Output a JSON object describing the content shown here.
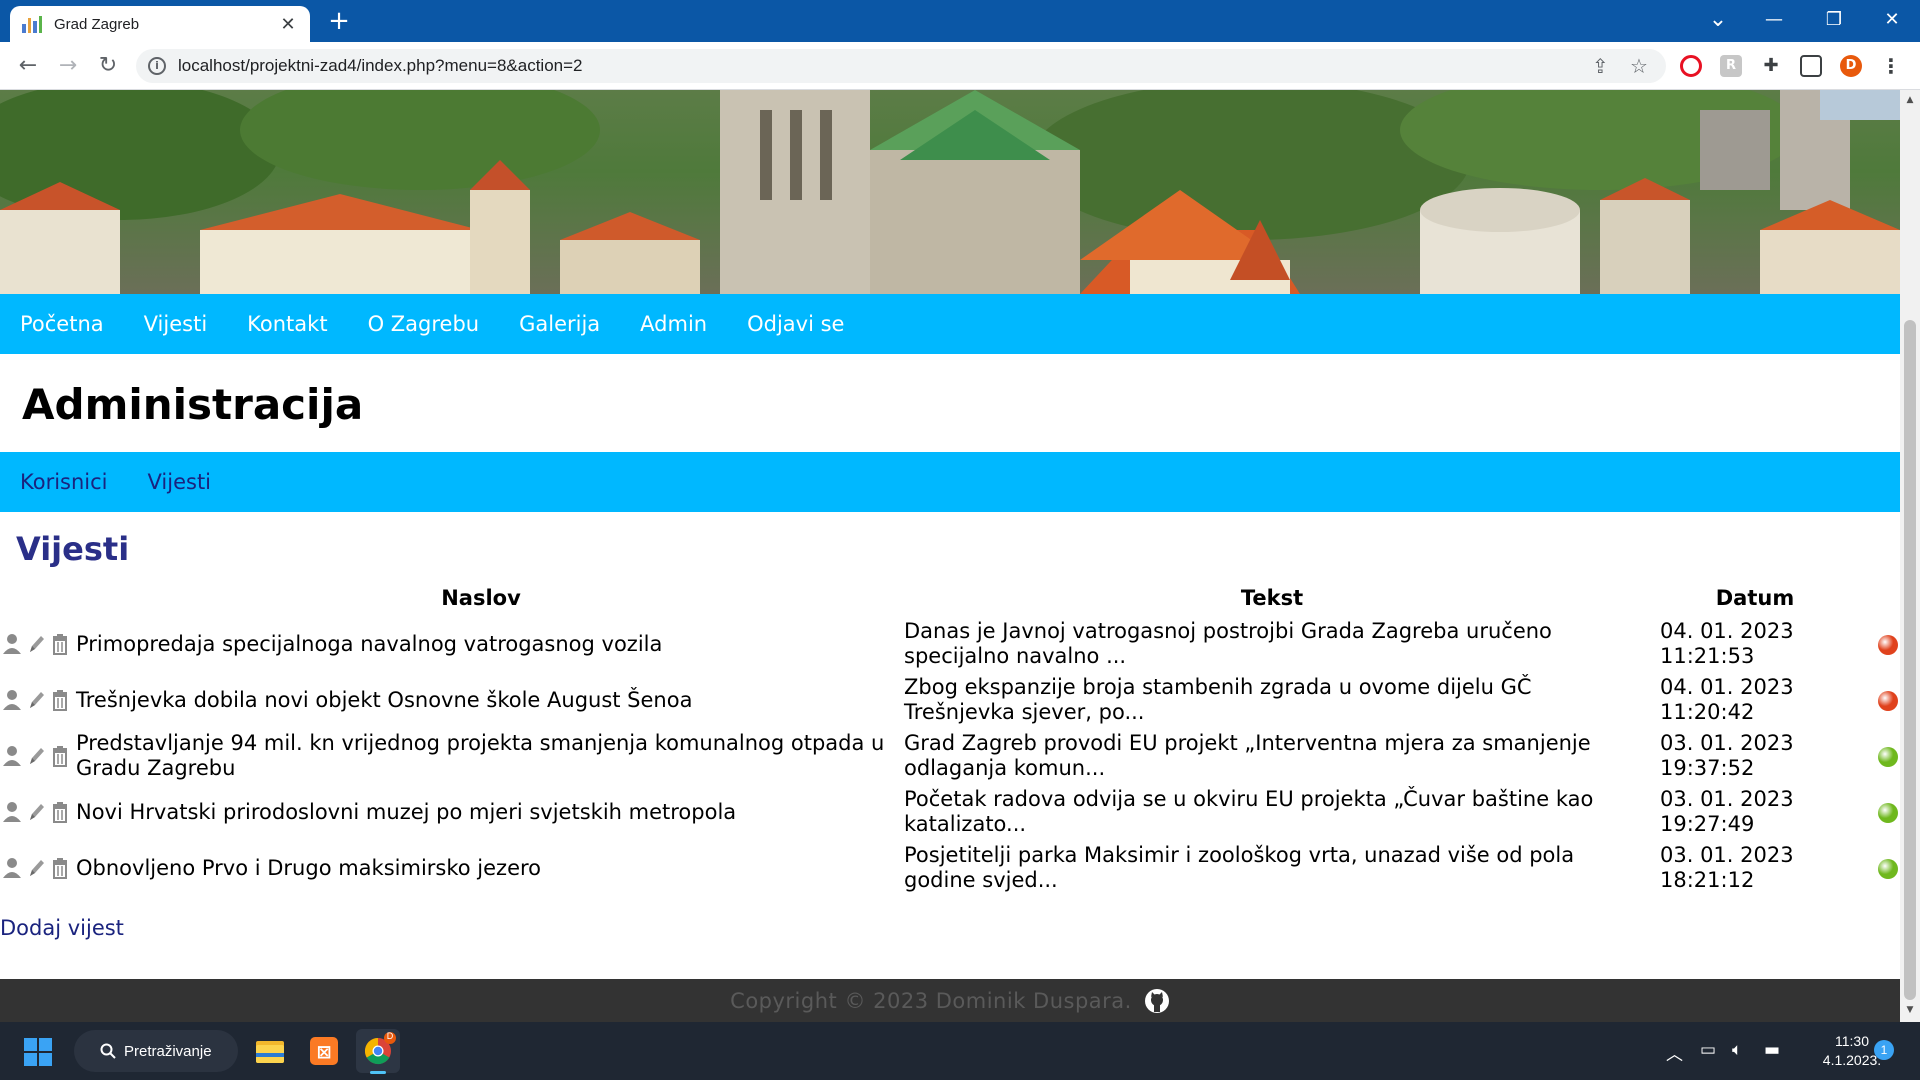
{
  "browser": {
    "tab_title": "Grad Zagreb",
    "tab_close": "✕",
    "new_tab": "+",
    "url": "localhost/projektni-zad4/index.php?menu=8&action=2",
    "profile_initial": "D",
    "window_controls": {
      "minimize": "—",
      "restore": "❐",
      "close": "✕",
      "tab_list": "⌄"
    }
  },
  "main_nav": [
    "Početna",
    "Vijesti",
    "Kontakt",
    "O Zagrebu",
    "Galerija",
    "Admin",
    "Odjavi se"
  ],
  "page_title": "Administracija",
  "admin_nav": [
    "Korisnici",
    "Vijesti"
  ],
  "section_title": "Vijesti",
  "news_table": {
    "headers": {
      "title": "Naslov",
      "text": "Tekst",
      "date": "Datum"
    },
    "rows": [
      {
        "title": "Primopredaja specijalnoga navalnog vatrogasnog vozila",
        "text": "Danas je Javnoj vatrogasnoj postrojbi Grada Zagreba uručeno specijalno navalno ...",
        "date": "04. 01. 2023",
        "time": "11:21:53",
        "status_color": "#e0421d"
      },
      {
        "title": "Trešnjevka dobila novi objekt Osnovne škole August Šenoa",
        "text": "Zbog ekspanzije broja stambenih zgrada u ovome dijelu GČ Trešnjevka sjever, po...",
        "date": "04. 01. 2023",
        "time": "11:20:42",
        "status_color": "#e0421d"
      },
      {
        "title": "Predstavljanje 94 mil. kn vrijednog projekta smanjenja komunalnog otpada u Gradu Zagrebu",
        "text": "Grad Zagreb provodi EU projekt „Interventna mjera za smanjenje odlaganja komun...",
        "date": "03. 01. 2023",
        "time": "19:37:52",
        "status_color": "#6fb81e"
      },
      {
        "title": "Novi Hrvatski prirodoslovni muzej po mjeri svjetskih metropola",
        "text": "Početak radova odvija se u okviru EU projekta „Čuvar baštine kao katalizato...",
        "date": "03. 01. 2023",
        "time": "19:27:49",
        "status_color": "#6fb81e"
      },
      {
        "title": "Obnovljeno Prvo i Drugo maksimirsko jezero",
        "text": "Posjetitelji parka Maksimir i zoološkog vrta, unazad više od pola godine svjed...",
        "date": "03. 01. 2023",
        "time": "18:21:12",
        "status_color": "#6fb81e"
      }
    ]
  },
  "add_link": "Dodaj vijest",
  "footer_text": "Copyright © 2023 Dominik Duspara.",
  "taskbar": {
    "search_label": "Pretraživanje",
    "time": "11:30",
    "date": "4.1.2023.",
    "notification_count": "1",
    "chrome_badge": "D"
  },
  "colors": {
    "nav": "#00b8ff",
    "tabbar": "#0b57a6",
    "footer": "#333333",
    "section_title": "#2a2f88"
  }
}
